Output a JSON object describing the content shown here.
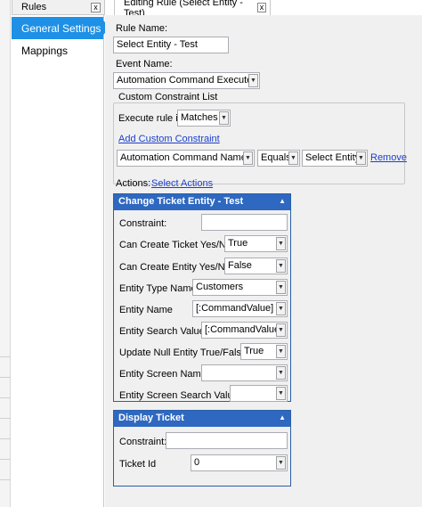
{
  "tabs": [
    {
      "label": "Rules",
      "close": "x"
    },
    {
      "label": "Editing Rule (Select Entity - Test)",
      "close": "x"
    }
  ],
  "nav": {
    "items": [
      {
        "label": "General Settings"
      },
      {
        "label": "Mappings"
      }
    ]
  },
  "form": {
    "rule_name_label": "Rule Name:",
    "rule_name_value": "Select Entity - Test",
    "event_name_label": "Event Name:",
    "event_name_value": "Automation Command Executed",
    "constraints": {
      "title": "Custom Constraint List",
      "execute_label": "Execute rule if",
      "execute_value": "Matches",
      "add_link": "Add Custom Constraint",
      "row": {
        "field": "Automation Command Name",
        "operator": "Equals",
        "value": "Select Entity",
        "remove": "Remove"
      }
    },
    "actions_label": "Actions:",
    "select_actions_link": "Select Actions"
  },
  "actions": [
    {
      "title": "Change Ticket Entity - Test",
      "fields": [
        {
          "label": "Constraint:",
          "type": "input",
          "value": ""
        },
        {
          "label": "Can Create Ticket Yes/No",
          "type": "select",
          "value": "True"
        },
        {
          "label": "Can Create Entity Yes/No",
          "type": "select",
          "value": "False"
        },
        {
          "label": "Entity Type Name",
          "type": "select",
          "value": "Customers"
        },
        {
          "label": "Entity Name",
          "type": "select",
          "value": "[:CommandValue]"
        },
        {
          "label": "Entity Search Value",
          "type": "select",
          "value": "[:CommandValue]"
        },
        {
          "label": "Update Null Entity True/False",
          "type": "select",
          "value": "True"
        },
        {
          "label": "Entity Screen Name",
          "type": "select",
          "value": ""
        },
        {
          "label": "Entity Screen Search Value",
          "type": "select",
          "value": ""
        }
      ]
    },
    {
      "title": "Display Ticket",
      "fields": [
        {
          "label": "Constraint:",
          "type": "input",
          "value": ""
        },
        {
          "label": "Ticket Id",
          "type": "select",
          "value": "0"
        }
      ]
    }
  ],
  "icons": {
    "dropdown": "dropdown-arrow-icon",
    "collapse": "collapse-caret-icon"
  },
  "colors": {
    "accent": "#1e90e6",
    "panel_header": "#2e68c0",
    "link": "#1a3fcc"
  }
}
